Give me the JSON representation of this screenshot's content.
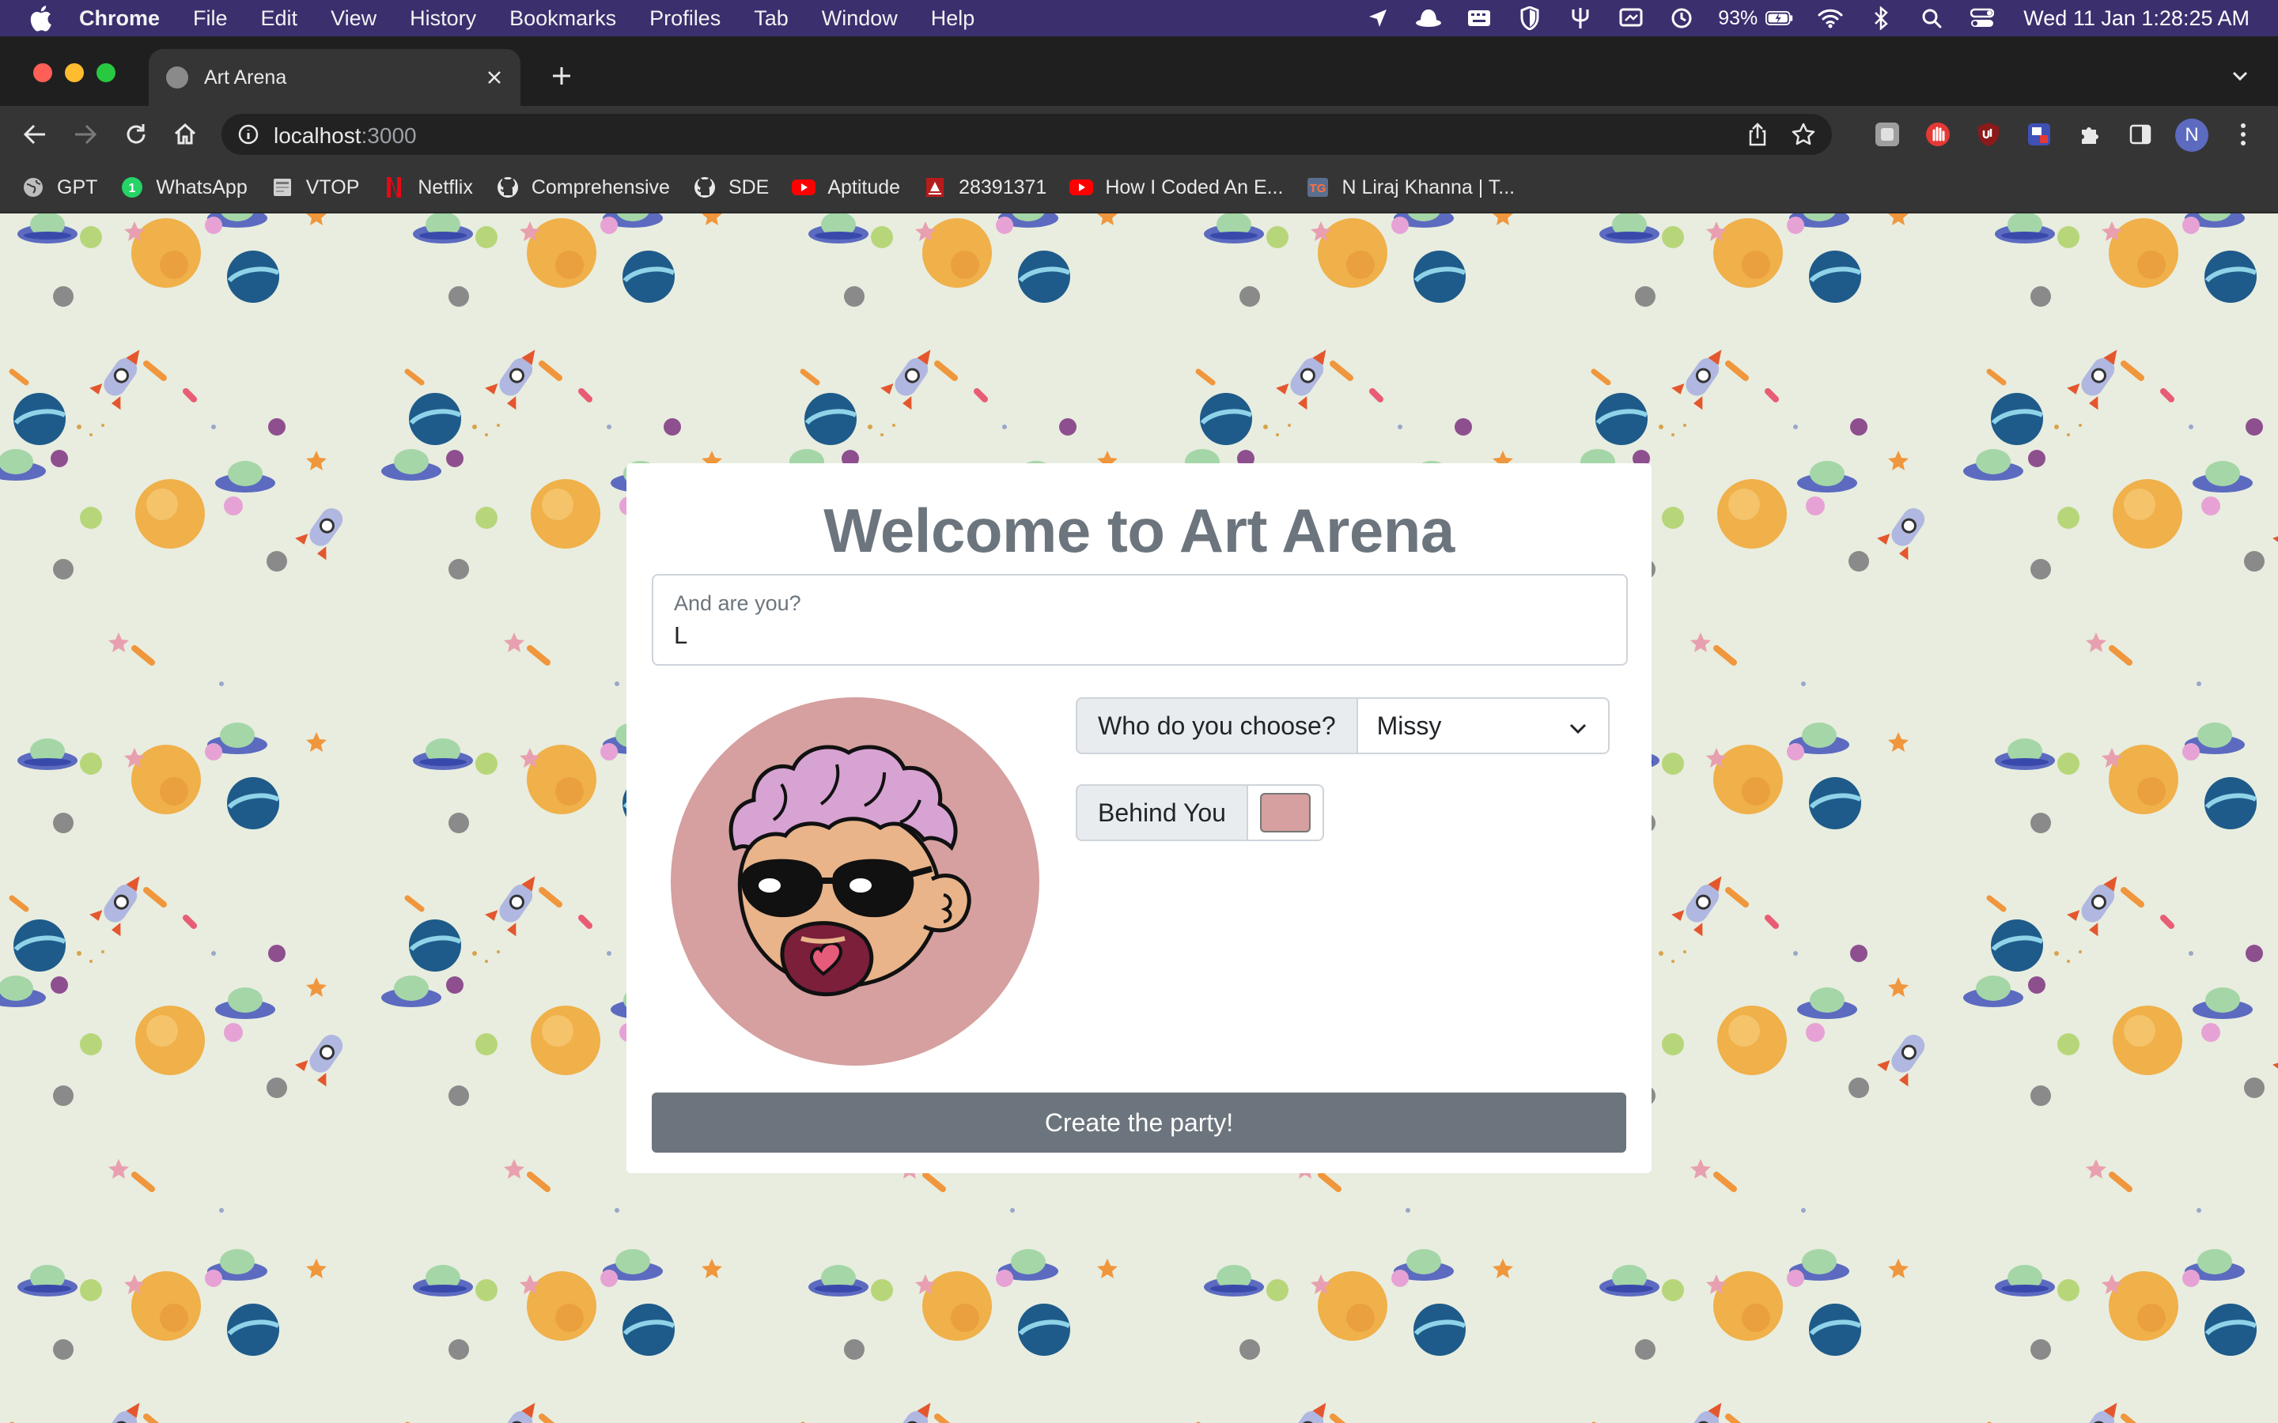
{
  "menubar": {
    "app_name": "Chrome",
    "items": [
      "File",
      "Edit",
      "View",
      "History",
      "Bookmarks",
      "Profiles",
      "Tab",
      "Window",
      "Help"
    ],
    "battery": "93%",
    "clock": "Wed 11 Jan  1:28:25 AM",
    "bar_color": "#3b2f6e"
  },
  "browser": {
    "tab_title": "Art Arena",
    "url_host": "localhost",
    "url_port": ":3000",
    "profile_initial": "N",
    "bookmarks": [
      {
        "label": "GPT",
        "icon": "globe-icon"
      },
      {
        "label": "WhatsApp",
        "icon": "whatsapp-icon"
      },
      {
        "label": "VTOP",
        "icon": "page-icon"
      },
      {
        "label": "Netflix",
        "icon": "netflix-icon"
      },
      {
        "label": "Comprehensive",
        "icon": "github-icon"
      },
      {
        "label": "SDE",
        "icon": "github-icon"
      },
      {
        "label": "Aptitude",
        "icon": "youtube-icon"
      },
      {
        "label": "28391371",
        "icon": "codeforces-icon"
      },
      {
        "label": "How I Coded An E...",
        "icon": "youtube-icon"
      },
      {
        "label": "N Liraj Khanna | T...",
        "icon": "tg-icon"
      }
    ]
  },
  "app": {
    "title": "Welcome to Art Arena",
    "name_field": {
      "label": "And are you?",
      "value": "L"
    },
    "character": {
      "label": "Who do you choose?",
      "selected": "Missy"
    },
    "background": {
      "label": "Behind You",
      "color": "#d5a09f"
    },
    "submit_label": "Create the party!",
    "colors": {
      "button": "#6c757d",
      "title": "#6c757d",
      "page_bg": "#e8eddf"
    }
  }
}
